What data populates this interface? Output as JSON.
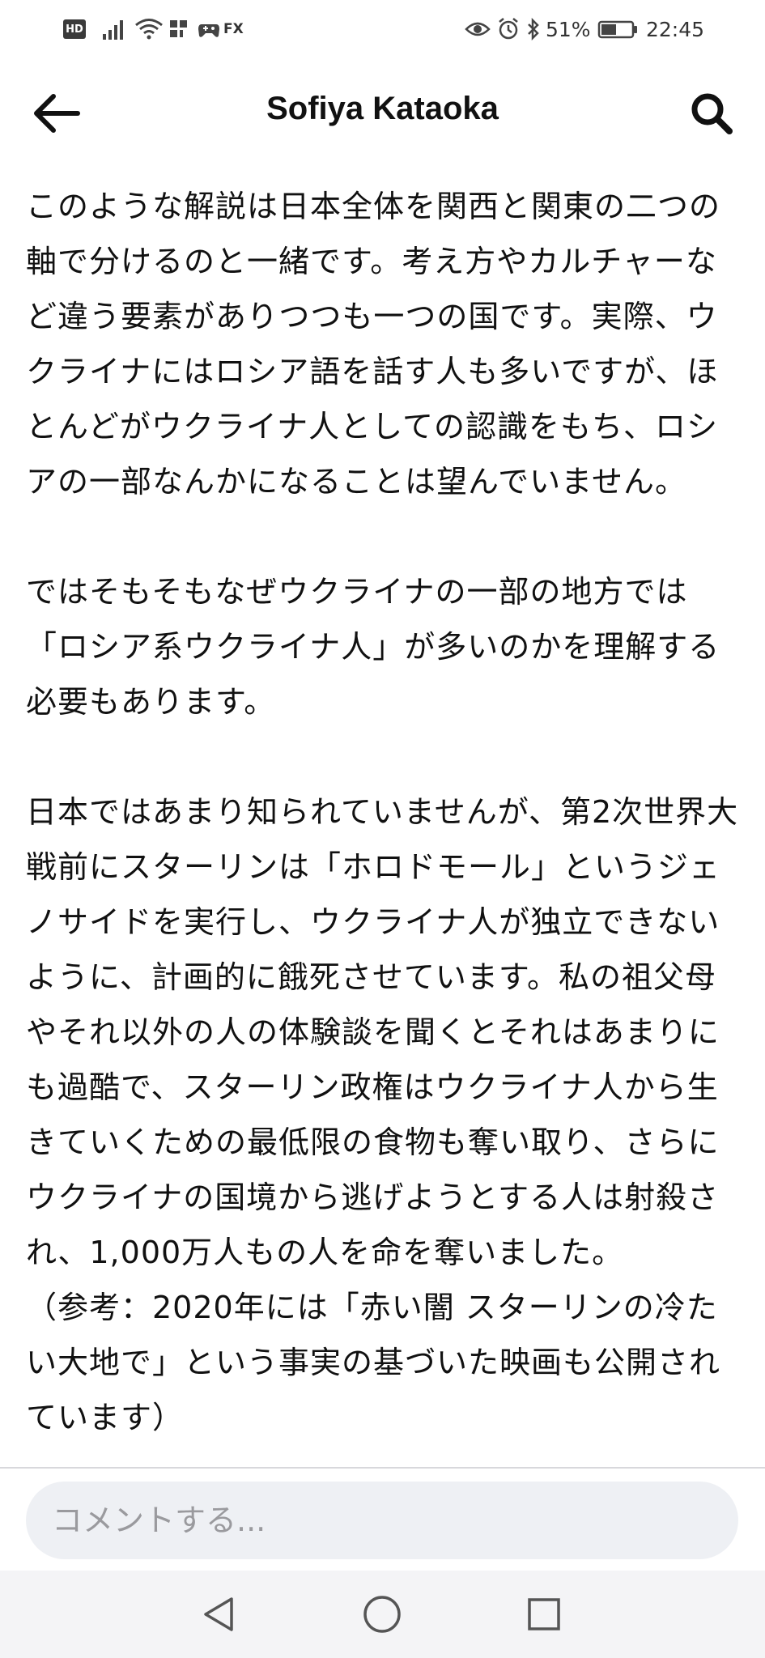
{
  "status_bar": {
    "hd_badge": "HD",
    "fx_label": "FX",
    "battery_percent": "51%",
    "time": "22:45",
    "battery_level": 0.51
  },
  "app_bar": {
    "title": "Sofiya Kataoka"
  },
  "article": {
    "paragraphs": [
      "このような解説は日本全体を関西と関東の二つの軸で分けるのと一緒です。考え方やカルチャーなど違う要素がありつつも一つの国です。実際、ウクライナにはロシア語を話す人も多いですが、ほとんどがウクライナ人としての認識をもち、ロシアの一部なんかになることは望んでいません。",
      "ではそもそもなぜウクライナの一部の地方では「ロシア系ウクライナ人」が多いのかを理解する必要もあります。",
      "日本ではあまり知られていませんが、第2次世界大戦前にスターリンは「ホロドモール」というジェノサイドを実行し、ウクライナ人が独立できないように、計画的に餓死させています。私の祖父母やそれ以外の人の体験談を聞くとそれはあまりにも過酷で、スターリン政権はウクライナ人から生きていくための最低限の食物も奪い取り、さらにウクライナの国境から逃げようとする人は射殺され、1,000万人もの人を命を奪いました。",
      "（参考：2020年には「赤い闇 スターリンの冷たい大地で」という事実の基づいた映画も公開されています）"
    ]
  },
  "comment": {
    "placeholder": "コメントする..."
  },
  "colors": {
    "text": "#111111",
    "input_bg": "#eef0f4",
    "placeholder": "#9a9a9e",
    "nav_bg": "#f4f4f6"
  }
}
